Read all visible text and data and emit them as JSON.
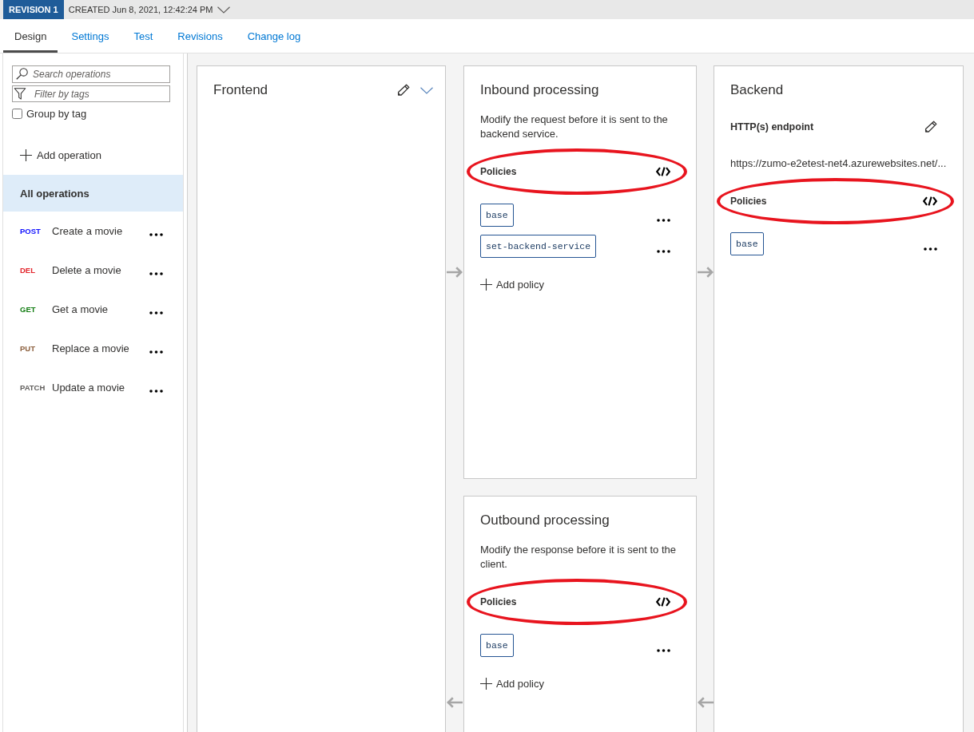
{
  "revision_bar": {
    "badge": "REVISION 1",
    "created": "CREATED Jun 8, 2021, 12:42:24 PM"
  },
  "tabs": [
    {
      "label": "Design",
      "selected": true
    },
    {
      "label": "Settings",
      "selected": false
    },
    {
      "label": "Test",
      "selected": false
    },
    {
      "label": "Revisions",
      "selected": false
    },
    {
      "label": "Change log",
      "selected": false
    }
  ],
  "sidebar": {
    "search": {
      "placeholder": "Search operations"
    },
    "filter": {
      "placeholder": "Filter by tags"
    },
    "group_by_tag": {
      "label": "Group by tag",
      "checked": false
    },
    "add_operation": "Add operation",
    "all_operations": {
      "label": "All operations",
      "selected": true
    },
    "operations": [
      {
        "method": "POST",
        "color": "#1010ff",
        "name": "Create a movie",
        "selected": false
      },
      {
        "method": "DEL",
        "color": "#e3242b",
        "name": "Delete a movie",
        "selected": false
      },
      {
        "method": "GET",
        "color": "#107c10",
        "name": "Get a movie",
        "selected": false
      },
      {
        "method": "PUT",
        "color": "#8b5e3c",
        "name": "Replace a movie",
        "selected": false
      },
      {
        "method": "PATCH",
        "color": "#605e5c",
        "name": "Update a movie",
        "selected": false
      }
    ]
  },
  "frontend": {
    "title": "Frontend"
  },
  "inbound": {
    "title": "Inbound processing",
    "description": "Modify the request before it is sent to the backend service.",
    "policies": {
      "label": "Policies",
      "highlighted": true,
      "items": [
        "base",
        "set-backend-service"
      ]
    },
    "add_policy": "Add policy"
  },
  "backend": {
    "title": "Backend",
    "endpoint_label": "HTTP(s) endpoint",
    "endpoint_url": "https://zumo-e2etest-net4.azurewebsites.net/...",
    "policies": {
      "label": "Policies",
      "highlighted": true,
      "items": [
        "base"
      ]
    }
  },
  "outbound": {
    "title": "Outbound processing",
    "description": "Modify the response before it is sent to the client.",
    "policies": {
      "label": "Policies",
      "highlighted": true,
      "items": [
        "base"
      ]
    },
    "add_policy": "Add policy"
  }
}
